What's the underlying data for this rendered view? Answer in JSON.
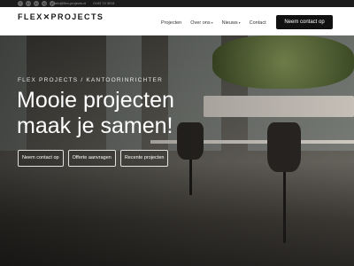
{
  "topbar": {
    "socials": [
      "f",
      "in",
      "in",
      "ig",
      "yt"
    ],
    "email": "info@flex-projects.nl",
    "phone": "0183 74 3031"
  },
  "nav": {
    "logo": "FLEX✕PROJECTS",
    "items": [
      "Projecten",
      "Over ons",
      "Nieuws",
      "Contact"
    ],
    "cta": "Neem contact op"
  },
  "hero": {
    "eyebrow": "FLEX PROJECTS / KANTOORINRICHTER",
    "headline_line1": "Mooie projecten",
    "headline_line2": "maak je samen!",
    "buttons": [
      "Neem contact op",
      "Offerte aanvragen",
      "Recente projecten"
    ]
  }
}
